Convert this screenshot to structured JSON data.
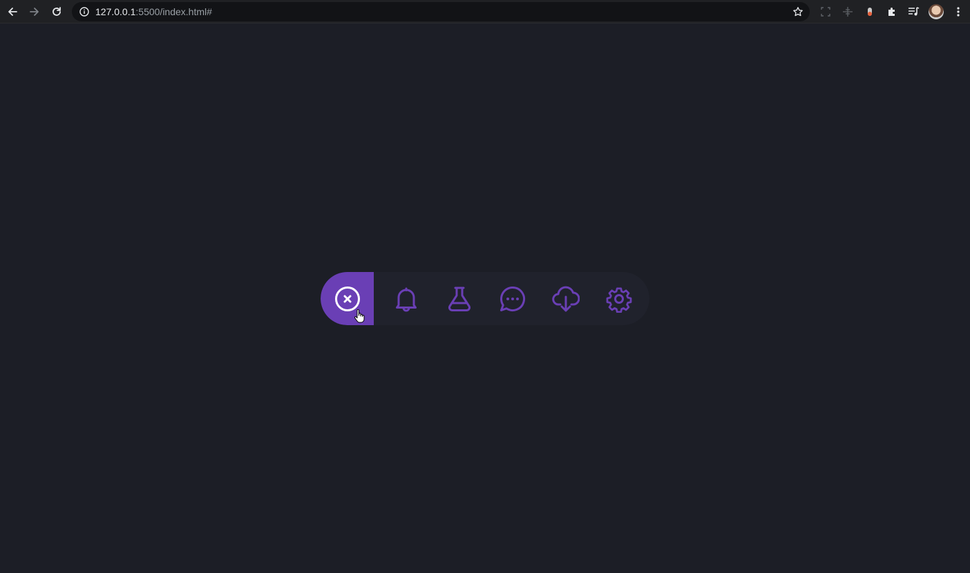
{
  "browser": {
    "url_host": "127.0.0.1",
    "url_path": ":5500/index.html#",
    "icons": [
      "back-arrow-icon",
      "forward-arrow-icon",
      "reload-icon",
      "info-icon",
      "star-icon",
      "extensions-icon",
      "media-control-icon",
      "menu-kebab-icon"
    ]
  },
  "menu": {
    "accent_color": "#6a3fb5",
    "icon_color": "#6a3fb5",
    "toggle_icon": "close-circle-icon",
    "items": [
      {
        "name": "bell",
        "icon": "bell-icon"
      },
      {
        "name": "flask",
        "icon": "flask-icon"
      },
      {
        "name": "chat",
        "icon": "chat-bubble-icon"
      },
      {
        "name": "download",
        "icon": "cloud-download-icon"
      },
      {
        "name": "settings",
        "icon": "gear-icon"
      }
    ]
  }
}
